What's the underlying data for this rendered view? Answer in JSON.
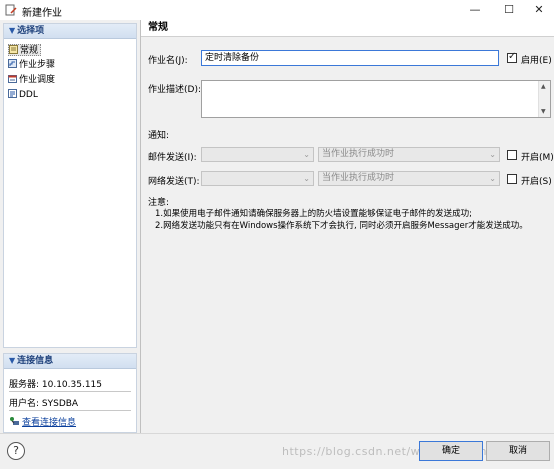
{
  "window": {
    "title": "新建作业"
  },
  "sidebar": {
    "section_title": "选择项",
    "items": [
      {
        "label": "常规",
        "selected": true
      },
      {
        "label": "作业步骤"
      },
      {
        "label": "作业调度"
      },
      {
        "label": "DDL"
      }
    ]
  },
  "connection": {
    "section_title": "连接信息",
    "server": "服务器: 10.10.35.115",
    "user": "用户名: SYSDBA",
    "view_link": "查看连接信息"
  },
  "main": {
    "section_title": "常规",
    "job_name_label": "作业名(J):",
    "job_name_value": "定时清除备份",
    "enable_label": "启用(E)",
    "enable_checked": true,
    "job_desc_label": "作业描述(D):",
    "job_desc_value": "",
    "notify_label": "通知:",
    "email_label": "邮件发送(I):",
    "email_combo_value": "",
    "email_condition": "当作业执行成功时",
    "email_enable_label": "开启(M)",
    "network_label": "网络发送(T):",
    "network_combo_value": "",
    "network_condition": "当作业执行成功时",
    "network_enable_label": "开启(S)",
    "notes_title": "注意:",
    "note1": "1.如果使用电子邮件通知请确保服务器上的防火墙设置能够保证电子邮件的发送成功;",
    "note2": "2.网络发送功能只有在Windows操作系统下才会执行, 同时必须开启服务Messager才能发送成功。"
  },
  "footer": {
    "help_icon": "?",
    "ok_label": "确定",
    "cancel_label": "取消",
    "watermark": "https://blog.csdn.net/weixin_xzhmtdu"
  },
  "colors": {
    "accent": "#3b78d8",
    "link": "#0a3f9c",
    "panel_header": "#1c3f7a"
  }
}
